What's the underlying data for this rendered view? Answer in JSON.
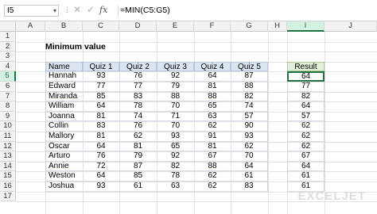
{
  "formula_bar": {
    "name_box": "I5",
    "separator": "⋮",
    "cancel_icon": "close-icon",
    "enter_icon": "check-icon",
    "fx_label": "fx",
    "formula": "=MIN(C5:G5)"
  },
  "columns": [
    "A",
    "B",
    "C",
    "D",
    "E",
    "F",
    "G",
    "H",
    "I",
    "J"
  ],
  "selected_column": "I",
  "rows": [
    "1",
    "2",
    "3",
    "4",
    "5",
    "6",
    "7",
    "8",
    "9",
    "10",
    "11",
    "12",
    "13",
    "14",
    "15",
    "16",
    "17"
  ],
  "selected_row": "5",
  "sheet": {
    "title": "Minimum value",
    "headers": [
      "Name",
      "Quiz 1",
      "Quiz 2",
      "Quiz 3",
      "Quiz 4",
      "Quiz 5"
    ],
    "result_header": "Result",
    "data": [
      {
        "name": "Hannah",
        "scores": [
          "93",
          "76",
          "92",
          "64",
          "87"
        ],
        "result": "64"
      },
      {
        "name": "Edward",
        "scores": [
          "77",
          "77",
          "79",
          "81",
          "88"
        ],
        "result": "77"
      },
      {
        "name": "Miranda",
        "scores": [
          "85",
          "83",
          "88",
          "88",
          "82"
        ],
        "result": "82"
      },
      {
        "name": "William",
        "scores": [
          "64",
          "78",
          "70",
          "65",
          "74"
        ],
        "result": "64"
      },
      {
        "name": "Joanna",
        "scores": [
          "81",
          "74",
          "71",
          "63",
          "57"
        ],
        "result": "57"
      },
      {
        "name": "Collin",
        "scores": [
          "83",
          "76",
          "70",
          "62",
          "90"
        ],
        "result": "62"
      },
      {
        "name": "Mallory",
        "scores": [
          "81",
          "62",
          "93",
          "91",
          "93"
        ],
        "result": "62"
      },
      {
        "name": "Oscar",
        "scores": [
          "64",
          "81",
          "65",
          "81",
          "62"
        ],
        "result": "62"
      },
      {
        "name": "Arturo",
        "scores": [
          "76",
          "79",
          "92",
          "67",
          "70"
        ],
        "result": "67"
      },
      {
        "name": "Annie",
        "scores": [
          "72",
          "87",
          "82",
          "88",
          "64"
        ],
        "result": "64"
      },
      {
        "name": "Weston",
        "scores": [
          "64",
          "85",
          "78",
          "62",
          "61"
        ],
        "result": "61"
      },
      {
        "name": "Joshua",
        "scores": [
          "93",
          "61",
          "63",
          "62",
          "83"
        ],
        "result": "61"
      }
    ]
  },
  "watermark": "EXCELJET",
  "colors": {
    "accent": "#217346",
    "table_header": "#dce6f2",
    "result_header": "#e2efda"
  }
}
